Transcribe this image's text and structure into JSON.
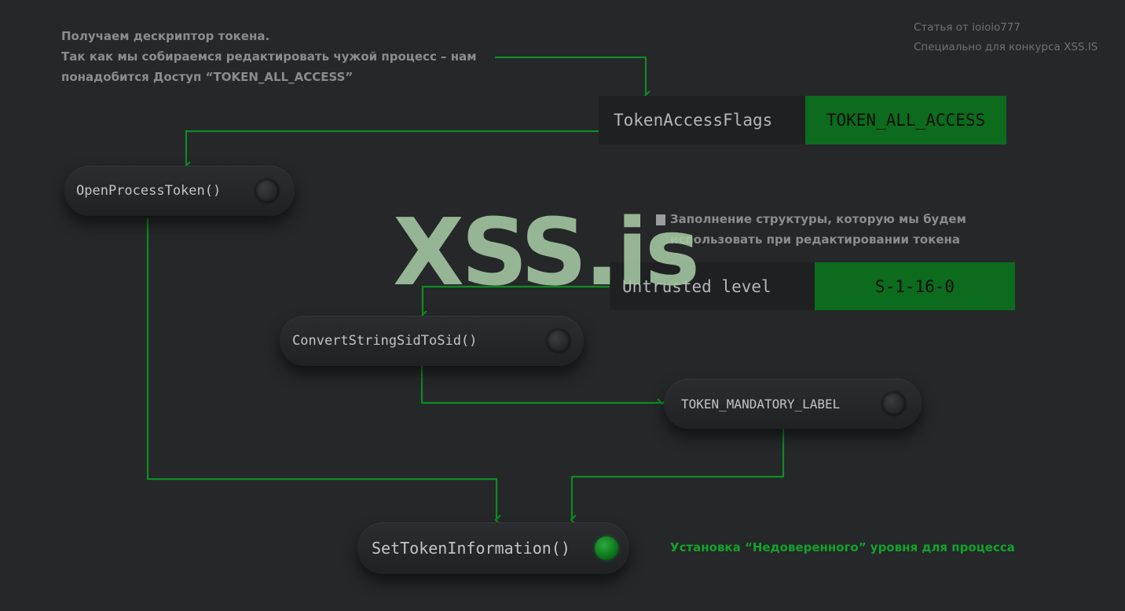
{
  "credit": {
    "line1": "Статья от ioioio777",
    "line2": "Специально для конкурса XSS.IS"
  },
  "notes": {
    "token_descriptor": [
      "Получаем дескриптор токена.",
      "Так как мы собираемся редактировать чужой процесс – нам",
      "понадобится Доступ “TOKEN_ALL_ACCESS”"
    ],
    "fill_structure": [
      "Заполнение структуры, которую мы будем",
      "использовать при редактировании токена"
    ],
    "install_level": "Установка “Недоверенного” уровня для процесса"
  },
  "params": {
    "access": {
      "label": "TokenAccessFlags",
      "value": "TOKEN_ALL_ACCESS"
    },
    "level": {
      "label": "Untrusted level",
      "value": "S-1-16-0"
    }
  },
  "nodes": {
    "open_process_token": "OpenProcessToken()",
    "convert_sid": "ConvertStringSidToSid()",
    "mandatory_label": "TOKEN_MANDATORY_LABEL",
    "set_token_info": "SetTokenInformation()"
  },
  "watermark": "XSS.is",
  "colors": {
    "background": "#252729",
    "accent_green": "#0c6b1c",
    "connector_green": "#0f8a23",
    "note_text": "#8a8c8f"
  }
}
